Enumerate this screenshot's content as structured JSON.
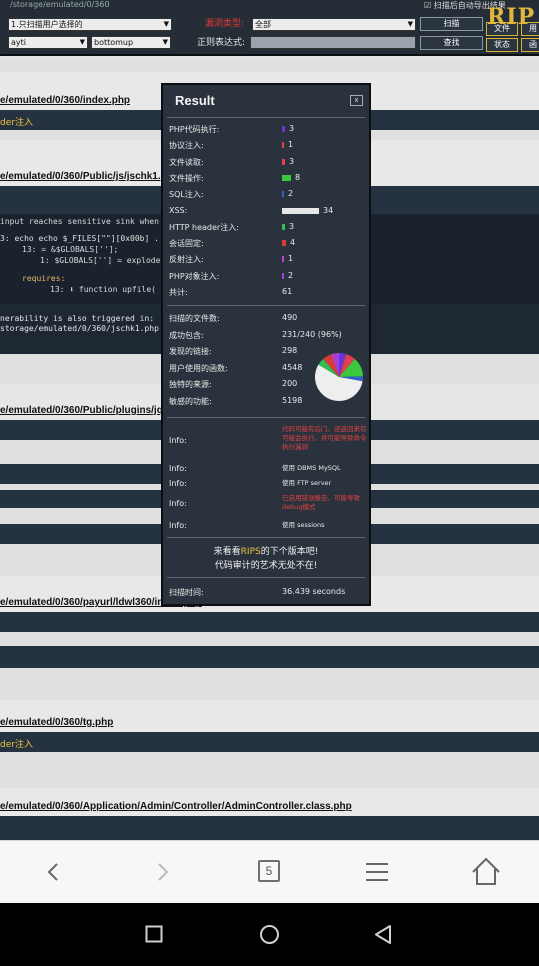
{
  "toolbar": {
    "path_text": "/storage/emulated/0/360",
    "top_right_text": "扫描后自动导出结果",
    "scan_mode_select": "1.只扫描用户选择的",
    "vuln_type_label": "漏洞类型:",
    "vuln_type_select": "全部",
    "scan_button": "扫描",
    "file_button": "文件",
    "file_button_2": "用",
    "code_style_select": "ayti",
    "position_select": "bottomup",
    "regex_label": "正则表达式:",
    "regex_value": "",
    "search_button": "查找",
    "status_button": "状态",
    "status_button_2": "函",
    "logo_text": "RIP"
  },
  "rows": [
    {
      "kind": "file",
      "text": "e/emulated/0/360/index.php"
    },
    {
      "kind": "type",
      "text": "der注入"
    },
    {
      "kind": "file",
      "text": "e/emulated/0/360/Public/js/jschk1.php"
    },
    {
      "kind": "code_intro",
      "text": "input reaches sensitive sink when"
    },
    {
      "kind": "code1",
      "text": "3: echo echo $_FILES[\"\"][0x00b] ."
    },
    {
      "kind": "code2",
      "text": "13:  = &$GLOBALS[''];"
    },
    {
      "kind": "code3",
      "text": "1: $GLOBALS[''] = explode(  , gzinflate(substr(  , 0x0a, -8)));"
    },
    {
      "kind": "code4",
      "text": "requires:"
    },
    {
      "kind": "code5",
      "text": "13: ⬇ function upfile("
    },
    {
      "kind": "trig1",
      "text": "nerability is also triggered in:"
    },
    {
      "kind": "trig2",
      "text": "storage/emulated/0/360/jschk1.php"
    },
    {
      "kind": "file",
      "text": "e/emulated/0/360/Public/plugins/jquery/php/action.php"
    },
    {
      "kind": "file",
      "text": "e/emulated/0/360/payurl/ldwl360/index.php"
    },
    {
      "kind": "file",
      "text": "e/emulated/0/360/tg.php"
    },
    {
      "kind": "type",
      "text": "der注入"
    },
    {
      "kind": "file",
      "text": "e/emulated/0/360/Application/Admin/Controller/AdminController.class.php"
    }
  ],
  "modal": {
    "title": "Result",
    "close_label": "x",
    "stats": [
      {
        "label": "PHP代码执行:",
        "value": "3",
        "count": 3,
        "color": "#6a35d6"
      },
      {
        "label": "协议注入:",
        "value": "1",
        "count": 1,
        "color": "#e04040"
      },
      {
        "label": "文件读取:",
        "value": "3",
        "count": 3,
        "color": "#e04050"
      },
      {
        "label": "文件操作:",
        "value": "8",
        "count": 8,
        "color": "#3cc83c"
      },
      {
        "label": "SQL注入:",
        "value": "2",
        "count": 2,
        "color": "#2f5fd0"
      },
      {
        "label": "XSS:",
        "value": "34",
        "count": 34,
        "color": "#e6e6e6"
      },
      {
        "label": "HTTP header注入:",
        "value": "3",
        "count": 3,
        "color": "#30c050"
      },
      {
        "label": "会话固定:",
        "value": "4",
        "count": 4,
        "color": "#d63a3a"
      },
      {
        "label": "反射注入:",
        "value": "1",
        "count": 1,
        "color": "#c040d0"
      },
      {
        "label": "PHP对象注入:",
        "value": "2",
        "count": 2,
        "color": "#a040e0"
      }
    ],
    "total_label": "共计:",
    "total_value": "61",
    "summary": [
      {
        "label": "扫描的文件数:",
        "value": "490"
      },
      {
        "label": "成功包含:",
        "value": "231/240 (96%)"
      },
      {
        "label": "发现的链接:",
        "value": "298"
      },
      {
        "label": "用户使用的函数:",
        "value": "4548"
      },
      {
        "label": "独特的来源:",
        "value": "200"
      },
      {
        "label": "敏感的功能:",
        "value": "5198"
      }
    ],
    "infos": [
      {
        "label": "Info:",
        "text": "代码可能有后门，还返回来有可能会执行，并可能导致命令执行漏洞",
        "red": true
      },
      {
        "label": "Info:",
        "text": "使用 DBMS MySQL",
        "red": false
      },
      {
        "label": "Info:",
        "text": "使用 FTP server",
        "red": false
      },
      {
        "label": "Info:",
        "text": "已启用错误报告，可能导致debug模式",
        "red": true
      },
      {
        "label": "Info:",
        "text": "使用 sessions",
        "red": false
      }
    ],
    "promo_line1": "来看看RIPS的下个版本吧!",
    "promo_highlight": "RIPS",
    "promo_line2": "代码审计的艺术无处不在!",
    "scan_time_label": "扫描时间:",
    "scan_time_value": "36.439 seconds"
  },
  "browser": {
    "tab_count": "5"
  }
}
